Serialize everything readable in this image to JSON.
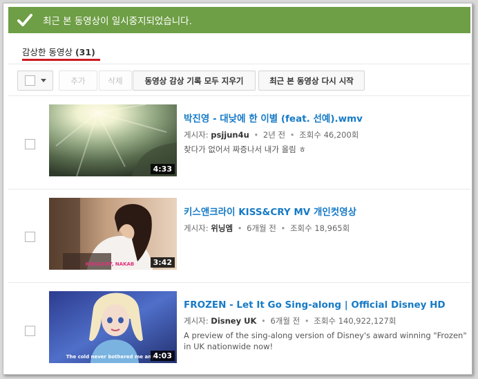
{
  "notice": {
    "text": "최근 본 동영상이 일시중지되었습니다."
  },
  "tab": {
    "label": "감상한 동영상",
    "count": "(31)"
  },
  "toolbar": {
    "add_label": "추가",
    "delete_label": "삭제",
    "clear_label": "동영상 감상 기록 모두 지우기",
    "resume_label": "최근 본 동영상 다시 시작"
  },
  "videos": [
    {
      "title": "박진영 - 대낮에 한 이별 (feat. 선예).wmv",
      "uploader_prefix": "게시자:",
      "uploader": "psjjun4u",
      "age": "2년 전",
      "views": "조회수 46,200회",
      "description": "찾다가 없어서 짜증나서 내가 올림 ㅎ",
      "duration": "4:33"
    },
    {
      "title": "키스앤크라이 KISS&CRY MV 개인컷영상",
      "uploader_prefix": "게시자:",
      "uploader": "위닝엠",
      "age": "6개월 전",
      "views": "조회수 18,965회",
      "description": "",
      "duration": "3:42",
      "thumb_caption": "KISS&CRY, NAKAB"
    },
    {
      "title": "FROZEN - Let It Go Sing-along | Official Disney HD",
      "uploader_prefix": "게시자:",
      "uploader": "Disney UK",
      "age": "6개월 전",
      "views": "조회수 140,922,127회",
      "description": "A preview of the sing-along version of Disney's award winning \"Frozen\" in UK nationwide now!",
      "duration": "4:03",
      "thumb_caption": "The cold never bothered me anyw"
    }
  ],
  "colors": {
    "notice_bg": "#6e9e45",
    "link": "#167ac6",
    "tab_underline": "#cc181e"
  }
}
